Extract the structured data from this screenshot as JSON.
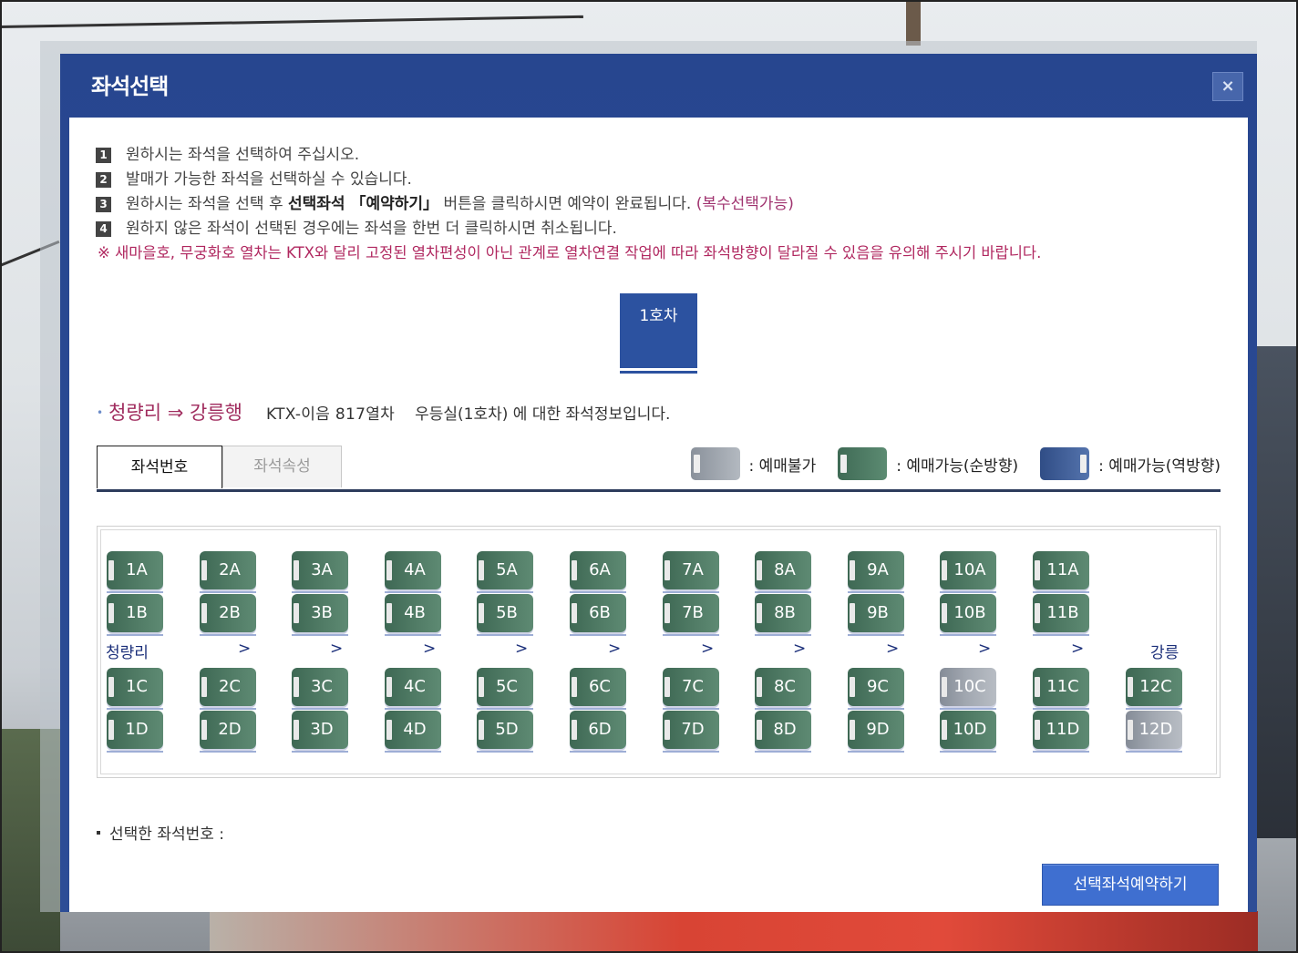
{
  "modal": {
    "title": "좌석선택",
    "close_label": "×"
  },
  "notes": [
    {
      "num": "1",
      "text": "원하시는 좌석을 선택하여 주십시오."
    },
    {
      "num": "2",
      "text": "발매가 가능한 좌석을 선택하실 수 있습니다."
    },
    {
      "num": "3",
      "pre": "원하시는 좌석을 선택 후 ",
      "bold": "선택좌석 「예약하기」",
      "post": " 버튼을 클릭하시면 예약이 완료됩니다. ",
      "accent": "(복수선택가능)"
    },
    {
      "num": "4",
      "text": "원하지 않은 좌석이 선택된 경우에는 좌석을 한번 더 클릭하시면 취소됩니다."
    }
  ],
  "warning": "※ 새마을호, 무궁화호 열차는 KTX와 달리 고정된 열차편성이 아닌 관계로 열차연결 작업에 따라 좌석방향이 달라질 수 있음을 유의해 주시기 바랍니다.",
  "car_tab": "1호차",
  "route": {
    "bullet": "•",
    "dest": "청량리 ⇒ 강릉행",
    "train": "KTX-이음 817열차",
    "info": "우등실(1호차) 에 대한 좌석정보입니다."
  },
  "tabs": {
    "seat_number": "좌석번호",
    "seat_attr": "좌석속성"
  },
  "legend": [
    {
      "type": "gray",
      "label": ": 예매불가"
    },
    {
      "type": "green",
      "label": ": 예매가능(순방향)"
    },
    {
      "type": "blue",
      "label": ": 예매가능(역방향)"
    }
  ],
  "direction": {
    "from": "청량리",
    "to": "강릉",
    "arrow": ">"
  },
  "seats": {
    "A": [
      {
        "id": "1A",
        "status": "avail"
      },
      {
        "id": "2A",
        "status": "avail"
      },
      {
        "id": "3A",
        "status": "avail"
      },
      {
        "id": "4A",
        "status": "avail"
      },
      {
        "id": "5A",
        "status": "avail"
      },
      {
        "id": "6A",
        "status": "avail"
      },
      {
        "id": "7A",
        "status": "avail"
      },
      {
        "id": "8A",
        "status": "avail"
      },
      {
        "id": "9A",
        "status": "avail"
      },
      {
        "id": "10A",
        "status": "avail"
      },
      {
        "id": "11A",
        "status": "avail"
      }
    ],
    "B": [
      {
        "id": "1B",
        "status": "avail"
      },
      {
        "id": "2B",
        "status": "avail"
      },
      {
        "id": "3B",
        "status": "avail"
      },
      {
        "id": "4B",
        "status": "avail"
      },
      {
        "id": "5B",
        "status": "avail"
      },
      {
        "id": "6B",
        "status": "avail"
      },
      {
        "id": "7B",
        "status": "avail"
      },
      {
        "id": "8B",
        "status": "avail"
      },
      {
        "id": "9B",
        "status": "avail"
      },
      {
        "id": "10B",
        "status": "avail"
      },
      {
        "id": "11B",
        "status": "avail"
      }
    ],
    "C": [
      {
        "id": "1C",
        "status": "avail"
      },
      {
        "id": "2C",
        "status": "avail"
      },
      {
        "id": "3C",
        "status": "avail"
      },
      {
        "id": "4C",
        "status": "avail"
      },
      {
        "id": "5C",
        "status": "avail"
      },
      {
        "id": "6C",
        "status": "avail"
      },
      {
        "id": "7C",
        "status": "avail"
      },
      {
        "id": "8C",
        "status": "avail"
      },
      {
        "id": "9C",
        "status": "avail"
      },
      {
        "id": "10C",
        "status": "sold"
      },
      {
        "id": "11C",
        "status": "avail"
      },
      {
        "id": "12C",
        "status": "avail"
      }
    ],
    "D": [
      {
        "id": "1D",
        "status": "avail"
      },
      {
        "id": "2D",
        "status": "avail"
      },
      {
        "id": "3D",
        "status": "avail"
      },
      {
        "id": "4D",
        "status": "avail"
      },
      {
        "id": "5D",
        "status": "avail"
      },
      {
        "id": "6D",
        "status": "avail"
      },
      {
        "id": "7D",
        "status": "avail"
      },
      {
        "id": "8D",
        "status": "avail"
      },
      {
        "id": "9D",
        "status": "avail"
      },
      {
        "id": "10D",
        "status": "avail"
      },
      {
        "id": "11D",
        "status": "avail"
      },
      {
        "id": "12D",
        "status": "sold"
      }
    ]
  },
  "selected_label": "선택한 좌석번호 :",
  "reserve_button": "선택좌석예약하기",
  "colors": {
    "modal_header": "#27468f",
    "seat_available": "#4f7a64",
    "seat_unavailable": "#a3a9b2",
    "route_accent": "#a02c5e",
    "button": "#3f6fd0"
  }
}
